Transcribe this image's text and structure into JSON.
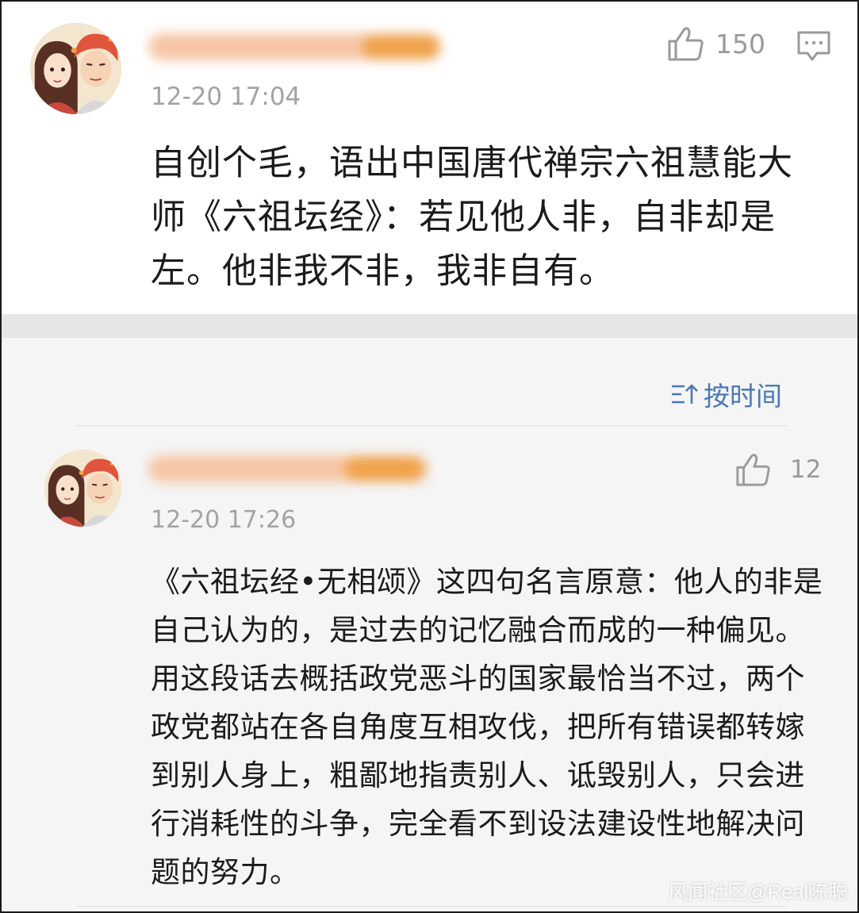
{
  "main_comment": {
    "timestamp": "12-20 17:04",
    "like_count": "150",
    "text": "自创个毛，语出中国唐代禅宗六祖慧能大师《六祖坛经》：若见他人非，自非却是左。他非我不非，我非自有。"
  },
  "sort": {
    "label": "按时间"
  },
  "reply": {
    "timestamp": "12-20 17:26",
    "like_count": "12",
    "text": "《六祖坛经•无相颂》这四句名言原意：他人的非是自己认为的，是过去的记忆融合而成的一种偏见。用这段话去概括政党恶斗的国家最恰当不过，两个政党都站在各自角度互相攻伐，把所有错误都转嫁到别人身上，粗鄙地指责别人、诋毁别人，只会进行消耗性的斗争，完全看不到设法建设性地解决问题的努力。"
  },
  "watermark": "风闻社区@Real陈聪",
  "colors": {
    "link_blue": "#4a79b5",
    "timestamp_gray": "#a3a3a3",
    "text_dark": "#1b1b1b"
  },
  "icons": [
    "avatar-illustration",
    "thumbs-up-icon",
    "comment-reply-icon",
    "sort-order-icon"
  ]
}
